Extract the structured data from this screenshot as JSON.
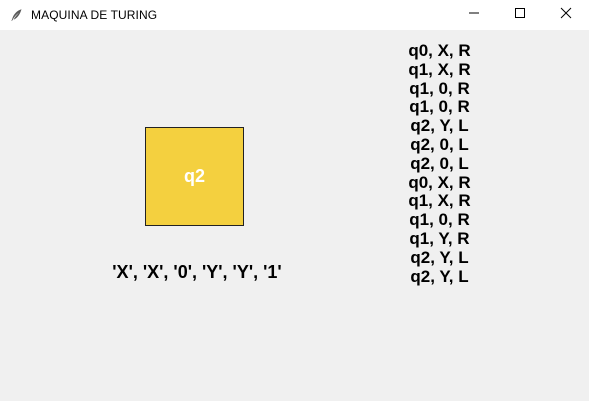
{
  "window": {
    "title": "MAQUINA DE TURING",
    "icon": "feather-icon",
    "controls": [
      "minimize-icon",
      "maximize-icon",
      "close-icon"
    ]
  },
  "machine": {
    "current_state": "q2",
    "state_color": "#f4d03f",
    "tape": "'X', 'X', '0', 'Y', 'Y', '1'"
  },
  "transitions": [
    "q0, X, R",
    "q1, X, R",
    "q1, 0, R",
    "q1, 0, R",
    "q2, Y, L",
    "q2, 0, L",
    "q2, 0, L",
    "q0, X, R",
    "q1, X, R",
    "q1, 0, R",
    "q1, Y, R",
    "q2, Y, L",
    "q2, Y, L"
  ]
}
